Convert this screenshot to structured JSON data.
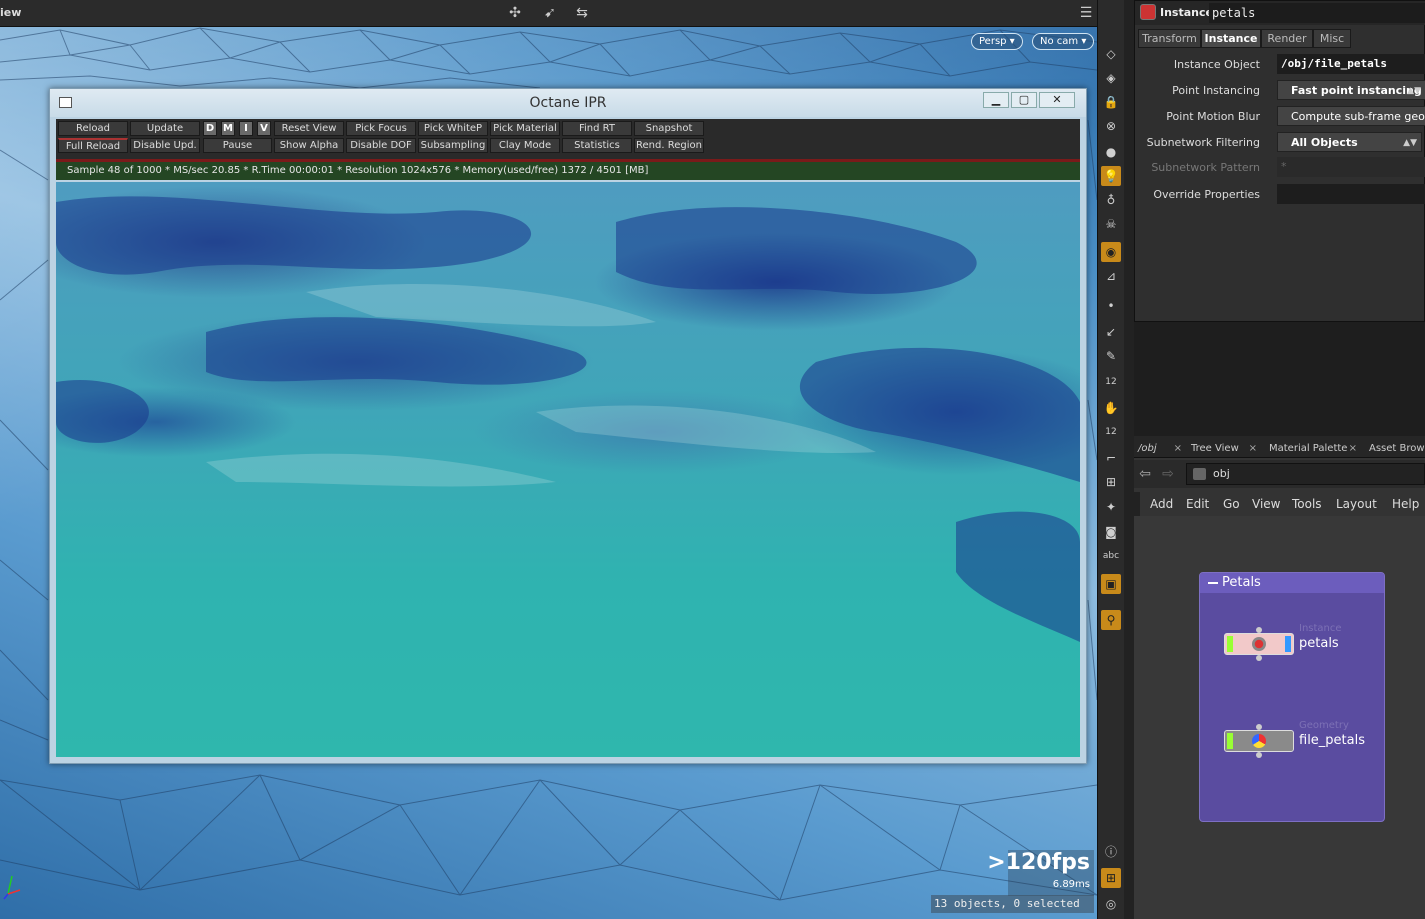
{
  "viewport": {
    "title": "iew",
    "camera_menu": "Persp",
    "cam_menu": "No cam",
    "fps": ">120fps",
    "frame_time": "6.89ms",
    "selection_status": "13 objects, 0 selected"
  },
  "ipr": {
    "title": "Octane IPR",
    "buttons_row1": [
      "Reload",
      "Update",
      "D",
      "M",
      "I",
      "V",
      "Reset View",
      "Pick Focus",
      "Pick WhiteP",
      "Pick Material",
      "Find RT",
      "Snapshot"
    ],
    "buttons_row2": [
      "Full Reload",
      "Disable Upd.",
      "Pause",
      "Show Alpha",
      "Disable DOF",
      "Subsampling",
      "Clay Mode",
      "Statistics",
      "Rend. Region"
    ],
    "status": "Sample 48 of 1000 * MS/sec 20.85 * R.Time 00:00:01 * Resolution 1024x576 * Memory(used/free) 1372 / 4501 [MB]"
  },
  "params": {
    "node_type": "Instance",
    "node_name": "petals",
    "tabs": [
      "Transform",
      "Instance",
      "Render",
      "Misc"
    ],
    "active_tab": "Instance",
    "fields": [
      {
        "label": "Instance Object",
        "value": "/obj/file_petals"
      },
      {
        "label": "Point Instancing",
        "value": "Fast point instancing"
      },
      {
        "label": "Point Motion Blur",
        "value": "Compute sub-frame geometry"
      },
      {
        "label": "Subnetwork Filtering",
        "value": "All Objects"
      },
      {
        "label": "Subnetwork Pattern",
        "value": "*"
      },
      {
        "label": "Override Properties",
        "value": ""
      }
    ]
  },
  "network": {
    "tabs": [
      "/obj",
      "Tree View",
      "Material Palette",
      "Asset Browser"
    ],
    "path": "obj",
    "menu": [
      "Add",
      "Edit",
      "Go",
      "View",
      "Tools",
      "Layout",
      "Help"
    ],
    "netbox_title": "Petals",
    "nodes": [
      {
        "type": "Instance",
        "name": "petals"
      },
      {
        "type": "Geometry",
        "name": "file_petals"
      }
    ]
  },
  "colors": {
    "accent_orange": "#c88a1a",
    "netbox": "#5a4ca0",
    "status_green": "#244623"
  }
}
